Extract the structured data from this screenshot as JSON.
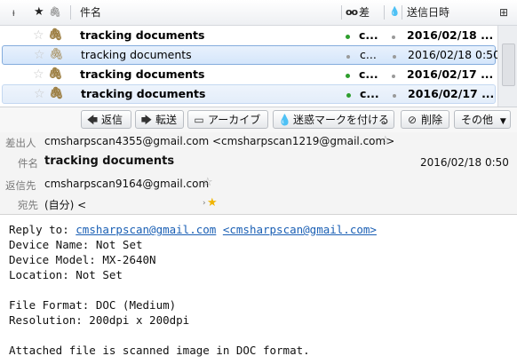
{
  "list": {
    "headers": {
      "col_thread_icon": "ᵼ",
      "col_star_icon": "★",
      "col_attach_icon": "🖇",
      "subject": "件名",
      "col_link_icon": "oo",
      "sender": "差",
      "col_status_icon": "💧",
      "date": "送信日時",
      "picker_icon": "⊞"
    },
    "rows": [
      {
        "subject": "tracking documents",
        "sender": "c...",
        "date": "2016/02/18 ...",
        "state": "unread"
      },
      {
        "subject": "tracking documents",
        "sender": "c...",
        "date": "2016/02/18 0:50",
        "state": "selected"
      },
      {
        "subject": "tracking documents",
        "sender": "c...",
        "date": "2016/02/17 ...",
        "state": "unread"
      },
      {
        "subject": "tracking documents",
        "sender": "c...",
        "date": "2016/02/17 ...",
        "state": "unread-alt"
      }
    ]
  },
  "toolbar": {
    "reply": "返信",
    "forward": "転送",
    "archive": "アーカイブ",
    "junk": "迷惑マークを付ける",
    "delete": "削除",
    "other": "その他"
  },
  "header": {
    "from_label": "差出人",
    "from_value": "cmsharpscan4355@gmail.com <cmsharpscan1219@gmail.com>",
    "subject_label": "件名",
    "subject_value": "tracking documents",
    "date_value": "2016/02/18 0:50",
    "replyto_label": "返信先",
    "replyto_value": "cmsharpscan9164@gmail.com",
    "to_label": "宛先",
    "to_value": "(自分) <"
  },
  "body": {
    "replyto_prefix": "Reply to: ",
    "replyto_link1": "cmsharpscan@gmail.com",
    "replyto_link2": "<cmsharpscan@gmail.com>",
    "line_device_name": "Device Name: Not Set",
    "line_device_model": "Device Model: MX-2640N",
    "line_location": "Location: Not Set",
    "line_file_format": "File Format: DOC (Medium)",
    "line_resolution": "Resolution: 200dpi x 200dpi",
    "line_attached": "Attached file is scanned image in DOC format."
  },
  "colors": {
    "unread_dot": "#2e9e2e",
    "selection": "#d5e6fb",
    "link": "#1a5fb4"
  }
}
